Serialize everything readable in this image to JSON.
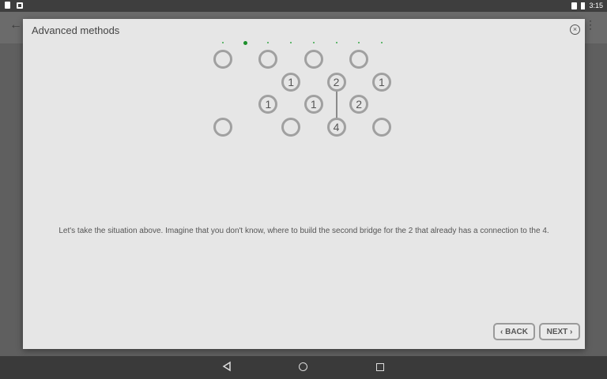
{
  "status_bar": {
    "time": "3:15"
  },
  "dialog": {
    "title": "Advanced methods",
    "close_icon": "close-circle-icon",
    "page_dots": {
      "count": 8,
      "active_index": 1
    },
    "text": "Let's take the situation above. Imagine that you don't know, where to build the second bridge for the 2 that already has a connection to the 4.",
    "back_label": "BACK",
    "next_label": "NEXT",
    "back_icon": "chevron-left-icon",
    "next_icon": "chevron-right-icon"
  },
  "puzzle": {
    "islands": [
      {
        "id": "i1",
        "value": "",
        "row": 0,
        "col": 0
      },
      {
        "id": "i2",
        "value": "",
        "row": 0,
        "col": 2
      },
      {
        "id": "i3",
        "value": "",
        "row": 0,
        "col": 4
      },
      {
        "id": "i4",
        "value": "",
        "row": 0,
        "col": 6
      },
      {
        "id": "i5",
        "value": "1",
        "row": 1,
        "col": 3
      },
      {
        "id": "i6",
        "value": "2",
        "row": 1,
        "col": 5
      },
      {
        "id": "i7",
        "value": "1",
        "row": 1,
        "col": 7
      },
      {
        "id": "i8",
        "value": "1",
        "row": 2,
        "col": 2
      },
      {
        "id": "i9",
        "value": "1",
        "row": 2,
        "col": 4
      },
      {
        "id": "i10",
        "value": "2",
        "row": 2,
        "col": 6
      },
      {
        "id": "i11",
        "value": "",
        "row": 3,
        "col": 0
      },
      {
        "id": "i12",
        "value": "",
        "row": 3,
        "col": 3
      },
      {
        "id": "i13",
        "value": "4",
        "row": 3,
        "col": 5
      },
      {
        "id": "i14",
        "value": "",
        "row": 3,
        "col": 7
      }
    ],
    "bridges": [
      {
        "from": "i6",
        "to": "i13",
        "count": 1
      }
    ]
  },
  "nav_bar": {
    "back_icon": "nav-back-icon",
    "home_icon": "nav-home-icon",
    "recent_icon": "nav-recent-icon"
  }
}
